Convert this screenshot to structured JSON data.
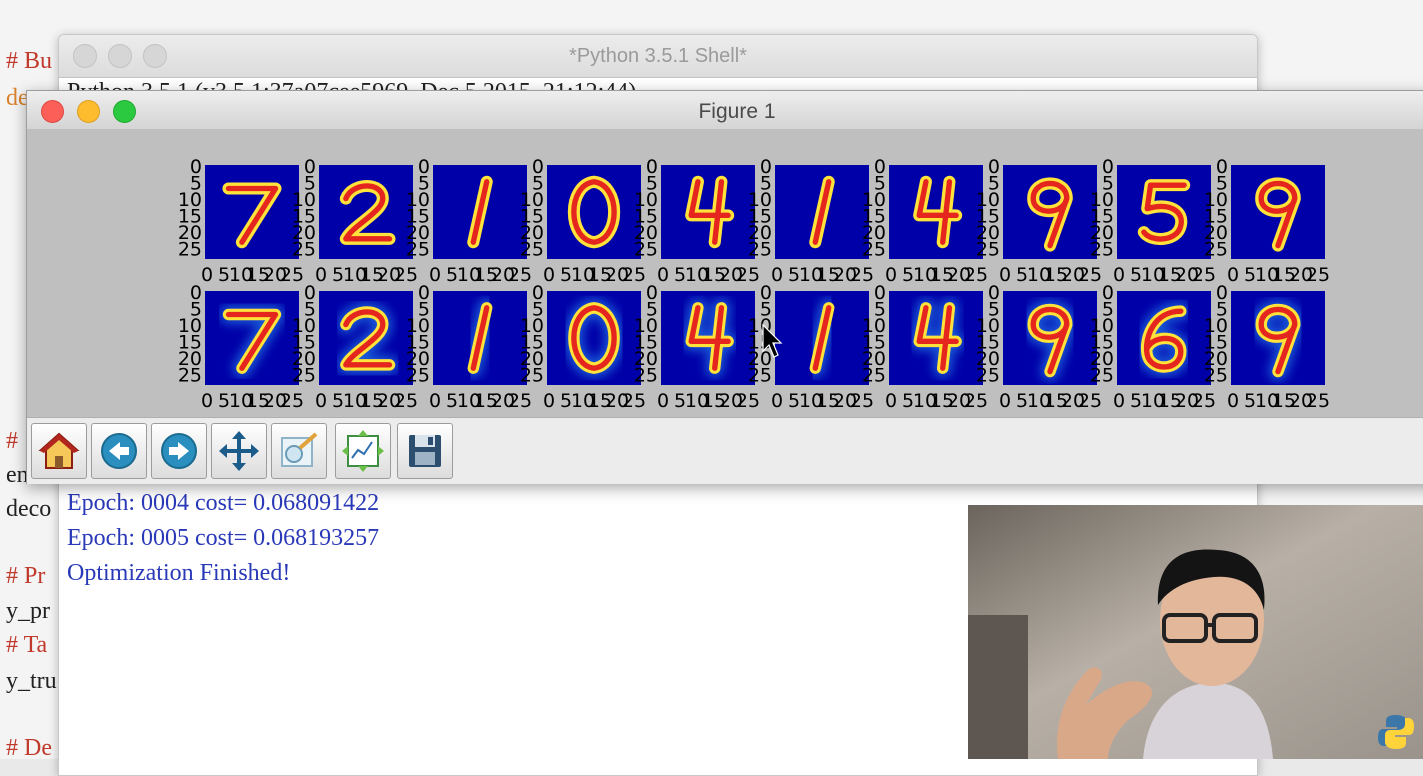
{
  "editor": {
    "lines": [
      {
        "text": "# Bu",
        "kind": "comment"
      },
      {
        "text": "de",
        "kind": "kw"
      },
      {
        "text": "# ",
        "kind": "comment"
      },
      {
        "text": "en",
        "kind": "plain"
      },
      {
        "text": "deco",
        "kind": "plain"
      },
      {
        "text": "# Pr",
        "kind": "comment"
      },
      {
        "text": "y_pr",
        "kind": "plain"
      },
      {
        "text": "# Ta",
        "kind": "comment"
      },
      {
        "text": "y_tru",
        "kind": "plain"
      },
      {
        "text": "# De",
        "kind": "comment"
      }
    ]
  },
  "shell": {
    "title": "*Python 3.5.1 Shell*",
    "first_line": "Python 3.5.1 (v3.5.1:37a07cee5969, Dec  5 2015, 21:12:44)",
    "output": [
      "Epoch: 0004 cost= 0.068091422",
      "Epoch: 0005 cost= 0.068193257",
      "Optimization Finished!"
    ]
  },
  "figure": {
    "title": "Figure 1",
    "digits_row1": [
      "7",
      "2",
      "1",
      "0",
      "4",
      "1",
      "4",
      "9",
      "5",
      "9"
    ],
    "digits_row2": [
      "7",
      "2",
      "1",
      "0",
      "4",
      "1",
      "4",
      "9",
      "6",
      "9"
    ],
    "ytick_labels": [
      "0",
      "5",
      "10",
      "15",
      "20",
      "25"
    ],
    "xtick_labels": [
      "0",
      "5",
      "10",
      "15",
      "20",
      "25"
    ],
    "colors": {
      "background": "#0000a8",
      "stroke_outer": "#ffe23a",
      "stroke_inner": "#e5261f",
      "halo": "#2fa4ff"
    }
  },
  "toolbar": {
    "buttons": [
      {
        "name": "home-button",
        "icon": "home-icon"
      },
      {
        "name": "back-button",
        "icon": "arrow-left-icon"
      },
      {
        "name": "forward-button",
        "icon": "arrow-right-icon"
      },
      {
        "name": "pan-button",
        "icon": "move-icon"
      },
      {
        "name": "zoom-button",
        "icon": "zoom-rect-icon"
      },
      {
        "name": "configure-subplots-button",
        "icon": "subplots-icon"
      },
      {
        "name": "save-button",
        "icon": "floppy-icon"
      }
    ]
  },
  "webcam": {
    "badge_icon": "python-logo-icon"
  }
}
